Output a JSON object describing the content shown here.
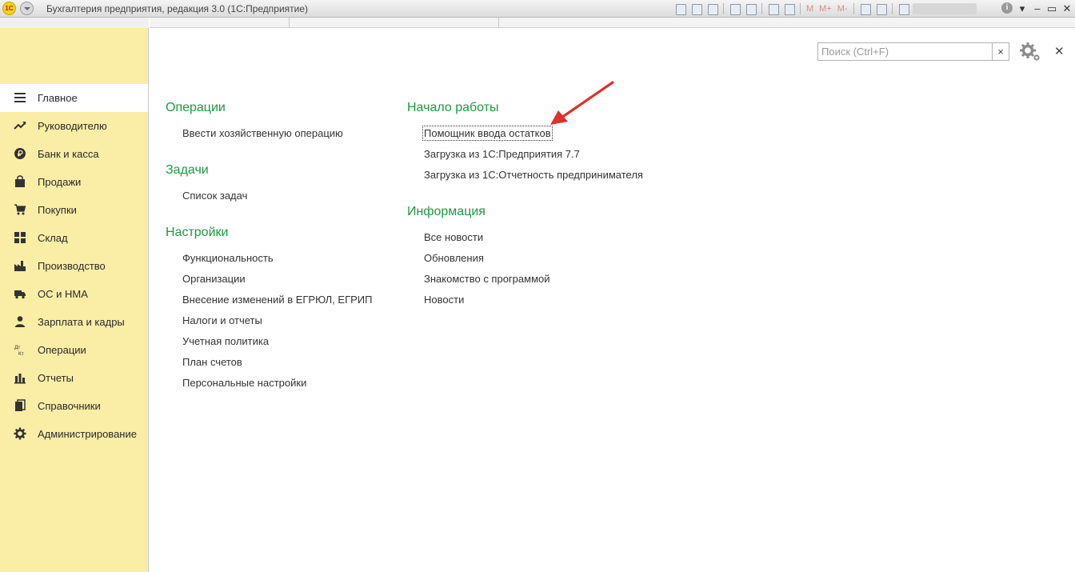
{
  "window": {
    "title": "Бухгалтерия предприятия, редакция 3.0  (1С:Предприятие)",
    "logo_text": "1С",
    "toolbar_text_buttons": [
      "M",
      "M+",
      "M-"
    ],
    "info_label": "i",
    "controls": {
      "minimize": "–",
      "restore": "▭",
      "close": "✕"
    }
  },
  "side_toolbar": {
    "icons": [
      "apps-grid-icon",
      "favorites-star-icon",
      "history-icon",
      "search-icon",
      "notifications-bell-icon"
    ]
  },
  "sidebar": {
    "items": [
      {
        "label": "Главное",
        "icon": "menu-lines-icon",
        "active": true
      },
      {
        "label": "Руководителю",
        "icon": "trend-up-icon"
      },
      {
        "label": "Банк и касса",
        "icon": "ruble-coin-icon"
      },
      {
        "label": "Продажи",
        "icon": "shopping-bag-icon"
      },
      {
        "label": "Покупки",
        "icon": "cart-icon"
      },
      {
        "label": "Склад",
        "icon": "warehouse-grid-icon"
      },
      {
        "label": "Производство",
        "icon": "factory-icon"
      },
      {
        "label": "ОС и НМА",
        "icon": "truck-icon"
      },
      {
        "label": "Зарплата и кадры",
        "icon": "person-icon"
      },
      {
        "label": "Операции",
        "icon": "debit-credit-icon"
      },
      {
        "label": "Отчеты",
        "icon": "bar-chart-icon"
      },
      {
        "label": "Справочники",
        "icon": "books-icon"
      },
      {
        "label": "Администрирование",
        "icon": "gear-icon"
      }
    ]
  },
  "search": {
    "placeholder": "Поиск (Ctrl+F)",
    "clear_label": "×"
  },
  "main": {
    "operations": {
      "title": "Операции",
      "links": [
        "Ввести хозяйственную операцию"
      ]
    },
    "tasks": {
      "title": "Задачи",
      "links": [
        "Список задач"
      ]
    },
    "settings": {
      "title": "Настройки",
      "links": [
        "Функциональность",
        "Организации",
        "Внесение изменений в ЕГРЮЛ, ЕГРИП",
        "Налоги и отчеты",
        "Учетная политика",
        "План счетов",
        "Персональные настройки"
      ]
    },
    "start": {
      "title": "Начало работы",
      "links": [
        "Помощник ввода остатков",
        "Загрузка из 1С:Предприятия 7.7",
        "Загрузка из 1С:Отчетность предпринимателя"
      ]
    },
    "info": {
      "title": "Информация",
      "links": [
        "Все новости",
        "Обновления",
        "Знакомство с программой",
        "Новости"
      ]
    }
  },
  "colors": {
    "section_heading": "#1c9b3f",
    "sidebar_bg": "#faeda6",
    "annotation_arrow": "#e0302a"
  }
}
